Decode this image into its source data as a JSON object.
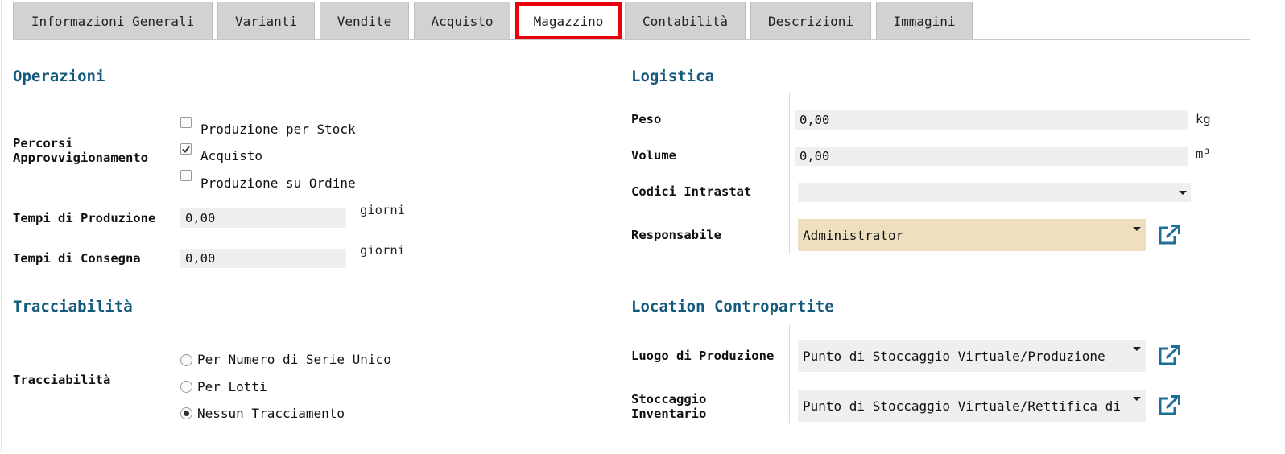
{
  "tabs": [
    {
      "label": "Informazioni Generali",
      "active": false
    },
    {
      "label": "Varianti",
      "active": false
    },
    {
      "label": "Vendite",
      "active": false
    },
    {
      "label": "Acquisto",
      "active": false
    },
    {
      "label": "Magazzino",
      "active": true
    },
    {
      "label": "Contabilità",
      "active": false
    },
    {
      "label": "Descrizioni",
      "active": false
    },
    {
      "label": "Immagini",
      "active": false
    }
  ],
  "operazioni": {
    "title": "Operazioni",
    "routes_label_line1": "Percorsi",
    "routes_label_line2": "Approvvigionamento",
    "routes": [
      {
        "label": "Produzione per Stock",
        "checked": false
      },
      {
        "label": "Acquisto",
        "checked": true
      },
      {
        "label": "Produzione su Ordine",
        "checked": false
      }
    ],
    "production_lead_label": "Tempi di Produzione",
    "production_lead_value": "0,00",
    "production_lead_unit": "giorni",
    "delivery_lead_label": "Tempi di Consegna",
    "delivery_lead_value": "0,00",
    "delivery_lead_unit": "giorni"
  },
  "logistica": {
    "title": "Logistica",
    "weight_label": "Peso",
    "weight_value": "0,00",
    "weight_unit": "kg",
    "volume_label": "Volume",
    "volume_value": "0,00",
    "volume_unit": "m³",
    "intrastat_label": "Codici Intrastat",
    "intrastat_value": "",
    "responsible_label": "Responsabile",
    "responsible_value": "Administrator"
  },
  "tracciabilita": {
    "title": "Tracciabilità",
    "label": "Tracciabilità",
    "options": [
      {
        "label": "Per Numero di Serie Unico",
        "selected": false
      },
      {
        "label": "Per Lotti",
        "selected": false
      },
      {
        "label": "Nessun Tracciamento",
        "selected": true
      }
    ]
  },
  "locations": {
    "title": "Location Contropartite",
    "production_label": "Luogo di Produzione",
    "production_value": "Punto di Stoccaggio Virtuale/Produzione",
    "inventory_label_line1": "Stoccaggio",
    "inventory_label_line2": "Inventario",
    "inventory_value": "Punto di Stoccaggio Virtuale/Rettifica di"
  },
  "colors": {
    "accent": "#145a7c",
    "active_tab_border": "#e8000b",
    "required_field": "#eedfbf",
    "icon": "#1d6f98"
  },
  "icons": {
    "external_link": "external-link-icon",
    "checkmark": "checkmark-icon",
    "dropdown": "chevron-down-icon"
  }
}
